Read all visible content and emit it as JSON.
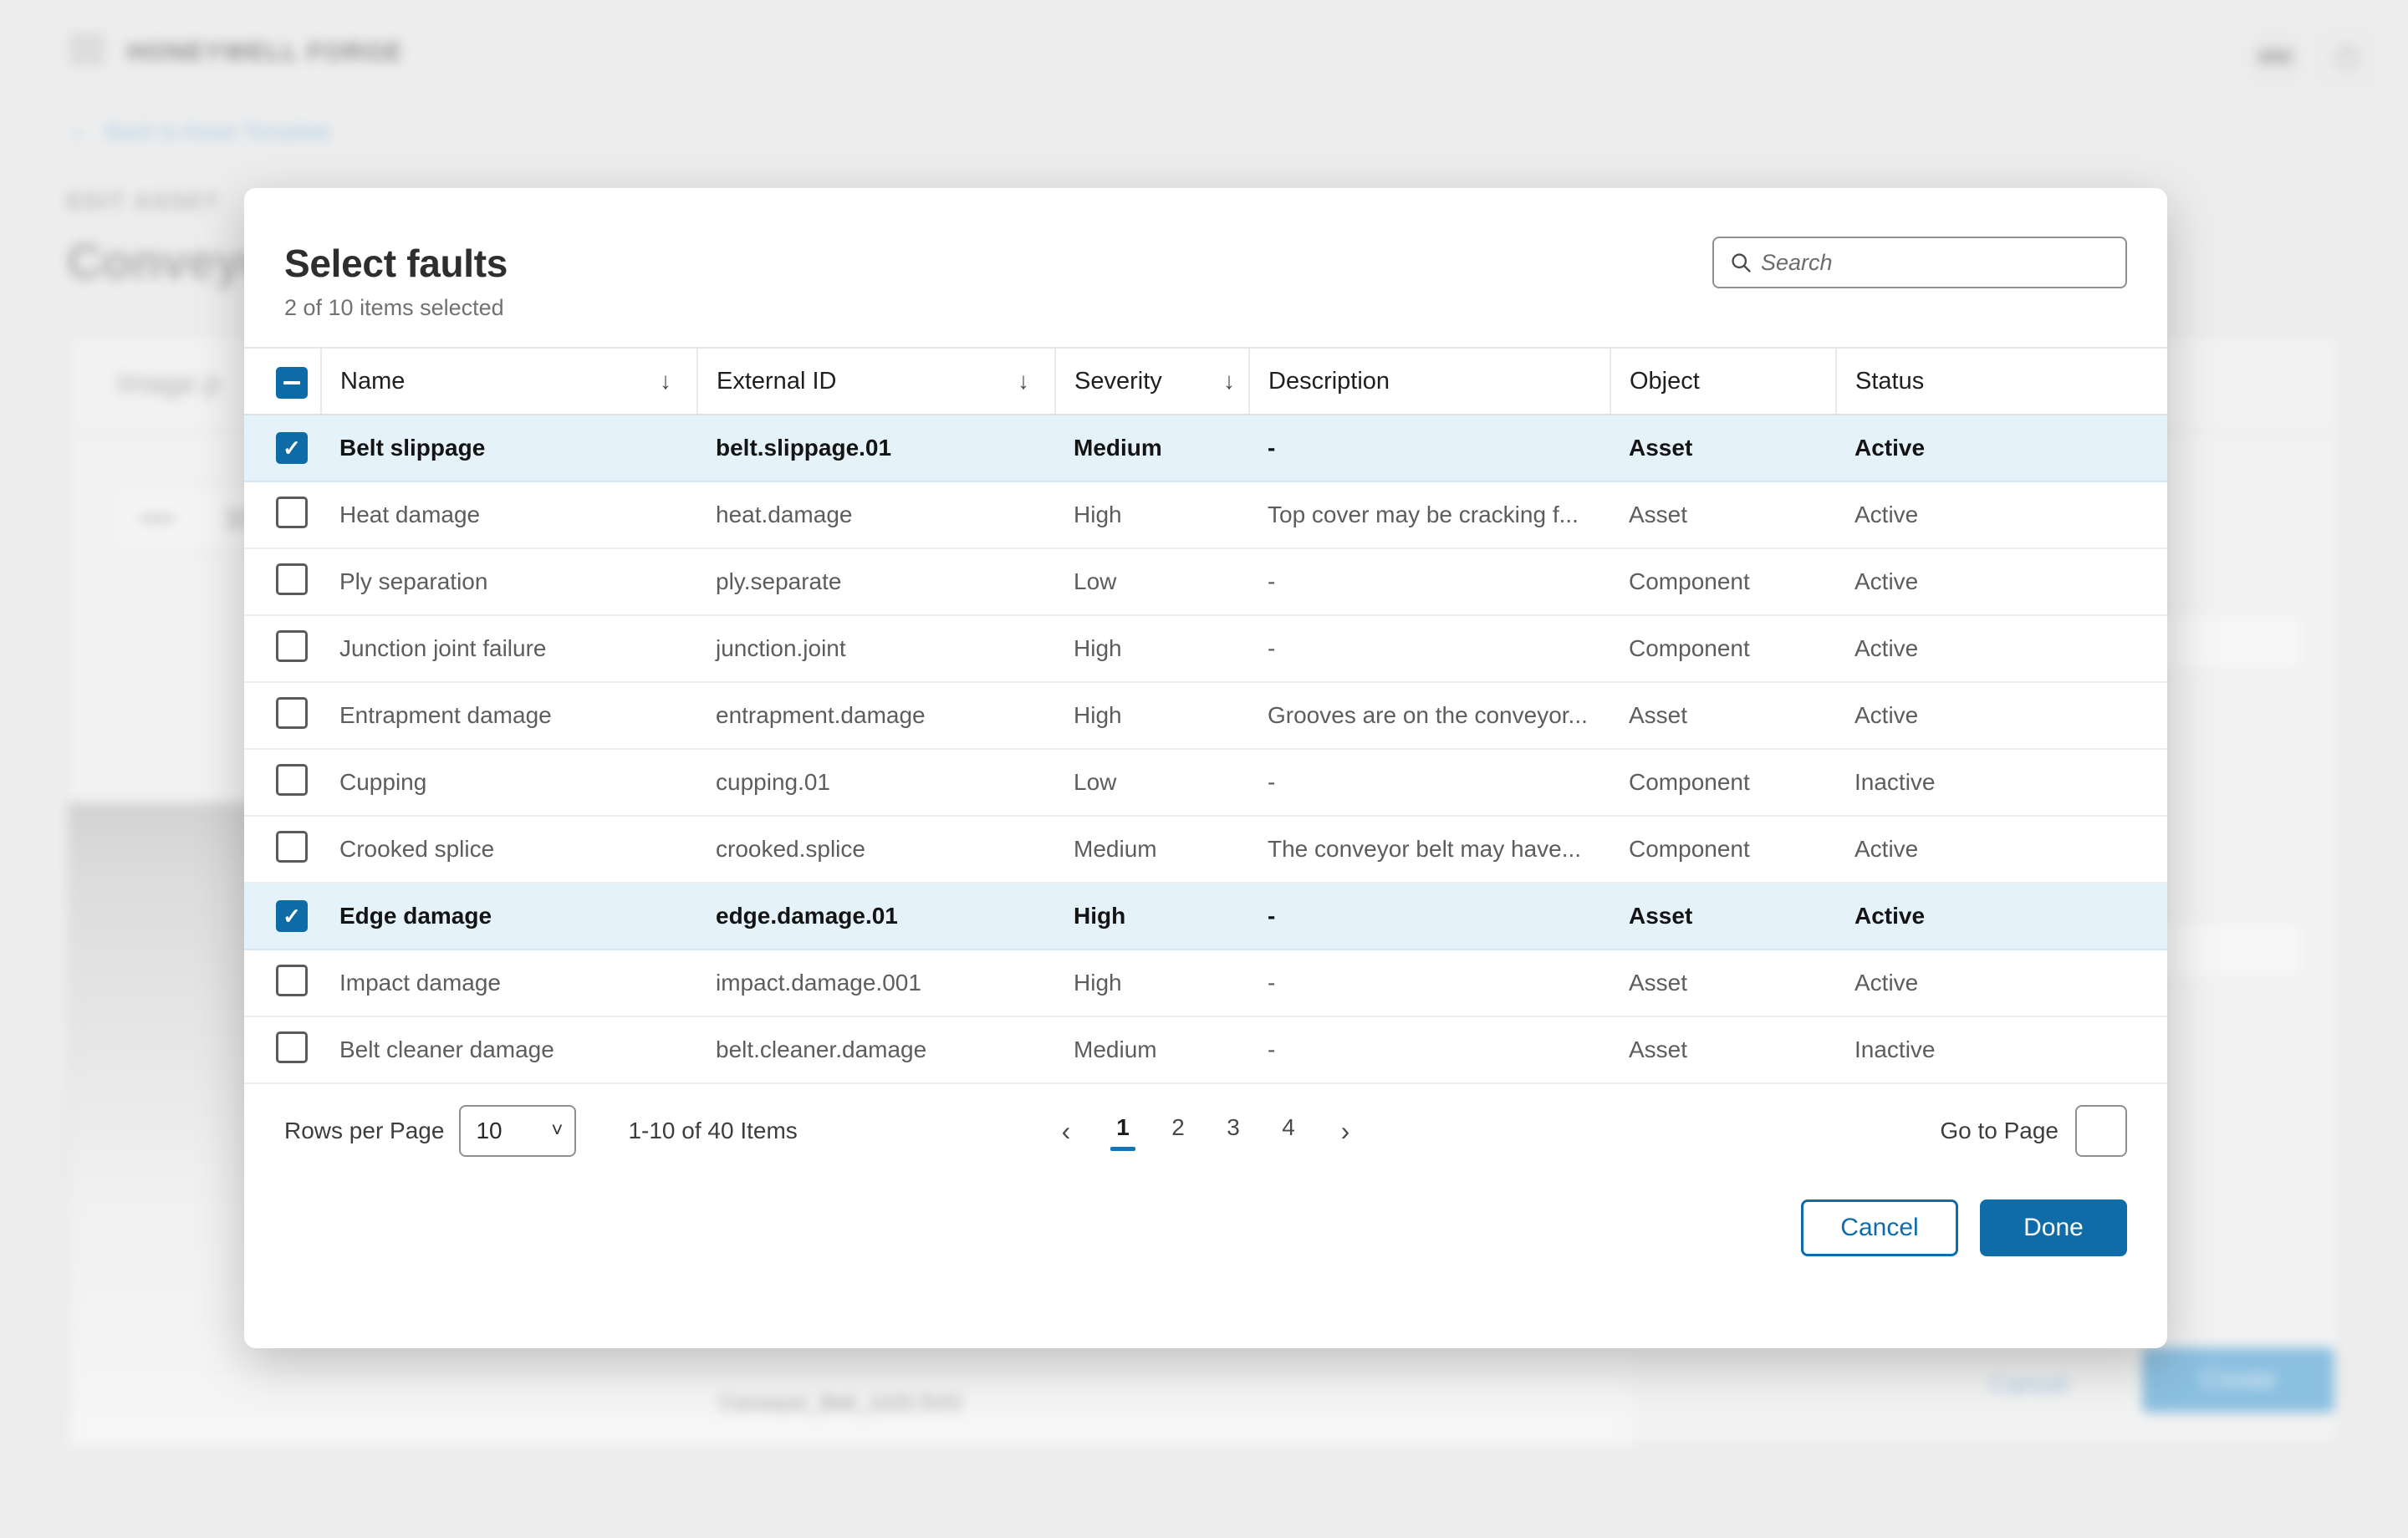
{
  "background": {
    "brand": "HONEYWELL FORGE",
    "back_link": "Back to Asset Template",
    "eyebrow": "EDIT ASSET",
    "page_title": "Conveyor",
    "card_title": "Image p",
    "zoom_level": "100",
    "filename": "Conveyor_Belt_1103.SVG",
    "cancel_label": "Cancel",
    "create_label": "Create",
    "avatar_initials": "MM",
    "help_glyph": "?"
  },
  "modal": {
    "title": "Select faults",
    "subtitle": "2 of 10 items selected",
    "search": {
      "value": "",
      "placeholder": "Search"
    },
    "columns": [
      {
        "label": "Name",
        "sortable": true
      },
      {
        "label": "External ID",
        "sortable": true
      },
      {
        "label": "Severity",
        "sortable": true
      },
      {
        "label": "Description",
        "sortable": false
      },
      {
        "label": "Object",
        "sortable": false
      },
      {
        "label": "Status",
        "sortable": false
      }
    ],
    "select_all_state": "indeterminate",
    "rows": [
      {
        "selected": true,
        "name": "Belt slippage",
        "external_id": "belt.slippage.01",
        "severity": "Medium",
        "description": "-",
        "object": "Asset",
        "status": "Active"
      },
      {
        "selected": false,
        "name": "Heat damage",
        "external_id": "heat.damage",
        "severity": "High",
        "description": "Top cover may be cracking f...",
        "object": "Asset",
        "status": "Active"
      },
      {
        "selected": false,
        "name": "Ply separation",
        "external_id": "ply.separate",
        "severity": "Low",
        "description": "-",
        "object": "Component",
        "status": "Active"
      },
      {
        "selected": false,
        "name": "Junction joint failure",
        "external_id": "junction.joint",
        "severity": "High",
        "description": "-",
        "object": "Component",
        "status": "Active"
      },
      {
        "selected": false,
        "name": "Entrapment damage",
        "external_id": "entrapment.damage",
        "severity": "High",
        "description": "Grooves are on the conveyor...",
        "object": "Asset",
        "status": "Active"
      },
      {
        "selected": false,
        "name": "Cupping",
        "external_id": "cupping.01",
        "severity": "Low",
        "description": "-",
        "object": "Component",
        "status": "Inactive"
      },
      {
        "selected": false,
        "name": "Crooked splice",
        "external_id": "crooked.splice",
        "severity": "Medium",
        "description": "The conveyor belt may have...",
        "object": "Component",
        "status": "Active"
      },
      {
        "selected": true,
        "name": "Edge damage",
        "external_id": "edge.damage.01",
        "severity": "High",
        "description": "-",
        "object": "Asset",
        "status": "Active"
      },
      {
        "selected": false,
        "name": "Impact damage",
        "external_id": "impact.damage.001",
        "severity": "High",
        "description": "-",
        "object": "Asset",
        "status": "Active"
      },
      {
        "selected": false,
        "name": "Belt cleaner damage",
        "external_id": "belt.cleaner.damage",
        "severity": "Medium",
        "description": "-",
        "object": "Asset",
        "status": "Inactive"
      }
    ],
    "pagination": {
      "rows_per_page_label": "Rows per Page",
      "rows_per_page_value": "10",
      "range_text": "1-10 of 40 Items",
      "prev_glyph": "‹",
      "next_glyph": "›",
      "pages": [
        "1",
        "2",
        "3",
        "4"
      ],
      "active_page": "1",
      "goto_label": "Go to Page",
      "goto_value": ""
    },
    "cancel_label": "Cancel",
    "done_label": "Done"
  },
  "colors": {
    "accent": "#0f6ca8",
    "checkbox": "#0d6ba8",
    "selected_row": "#e5f2fa",
    "page_background": "#ededed"
  }
}
